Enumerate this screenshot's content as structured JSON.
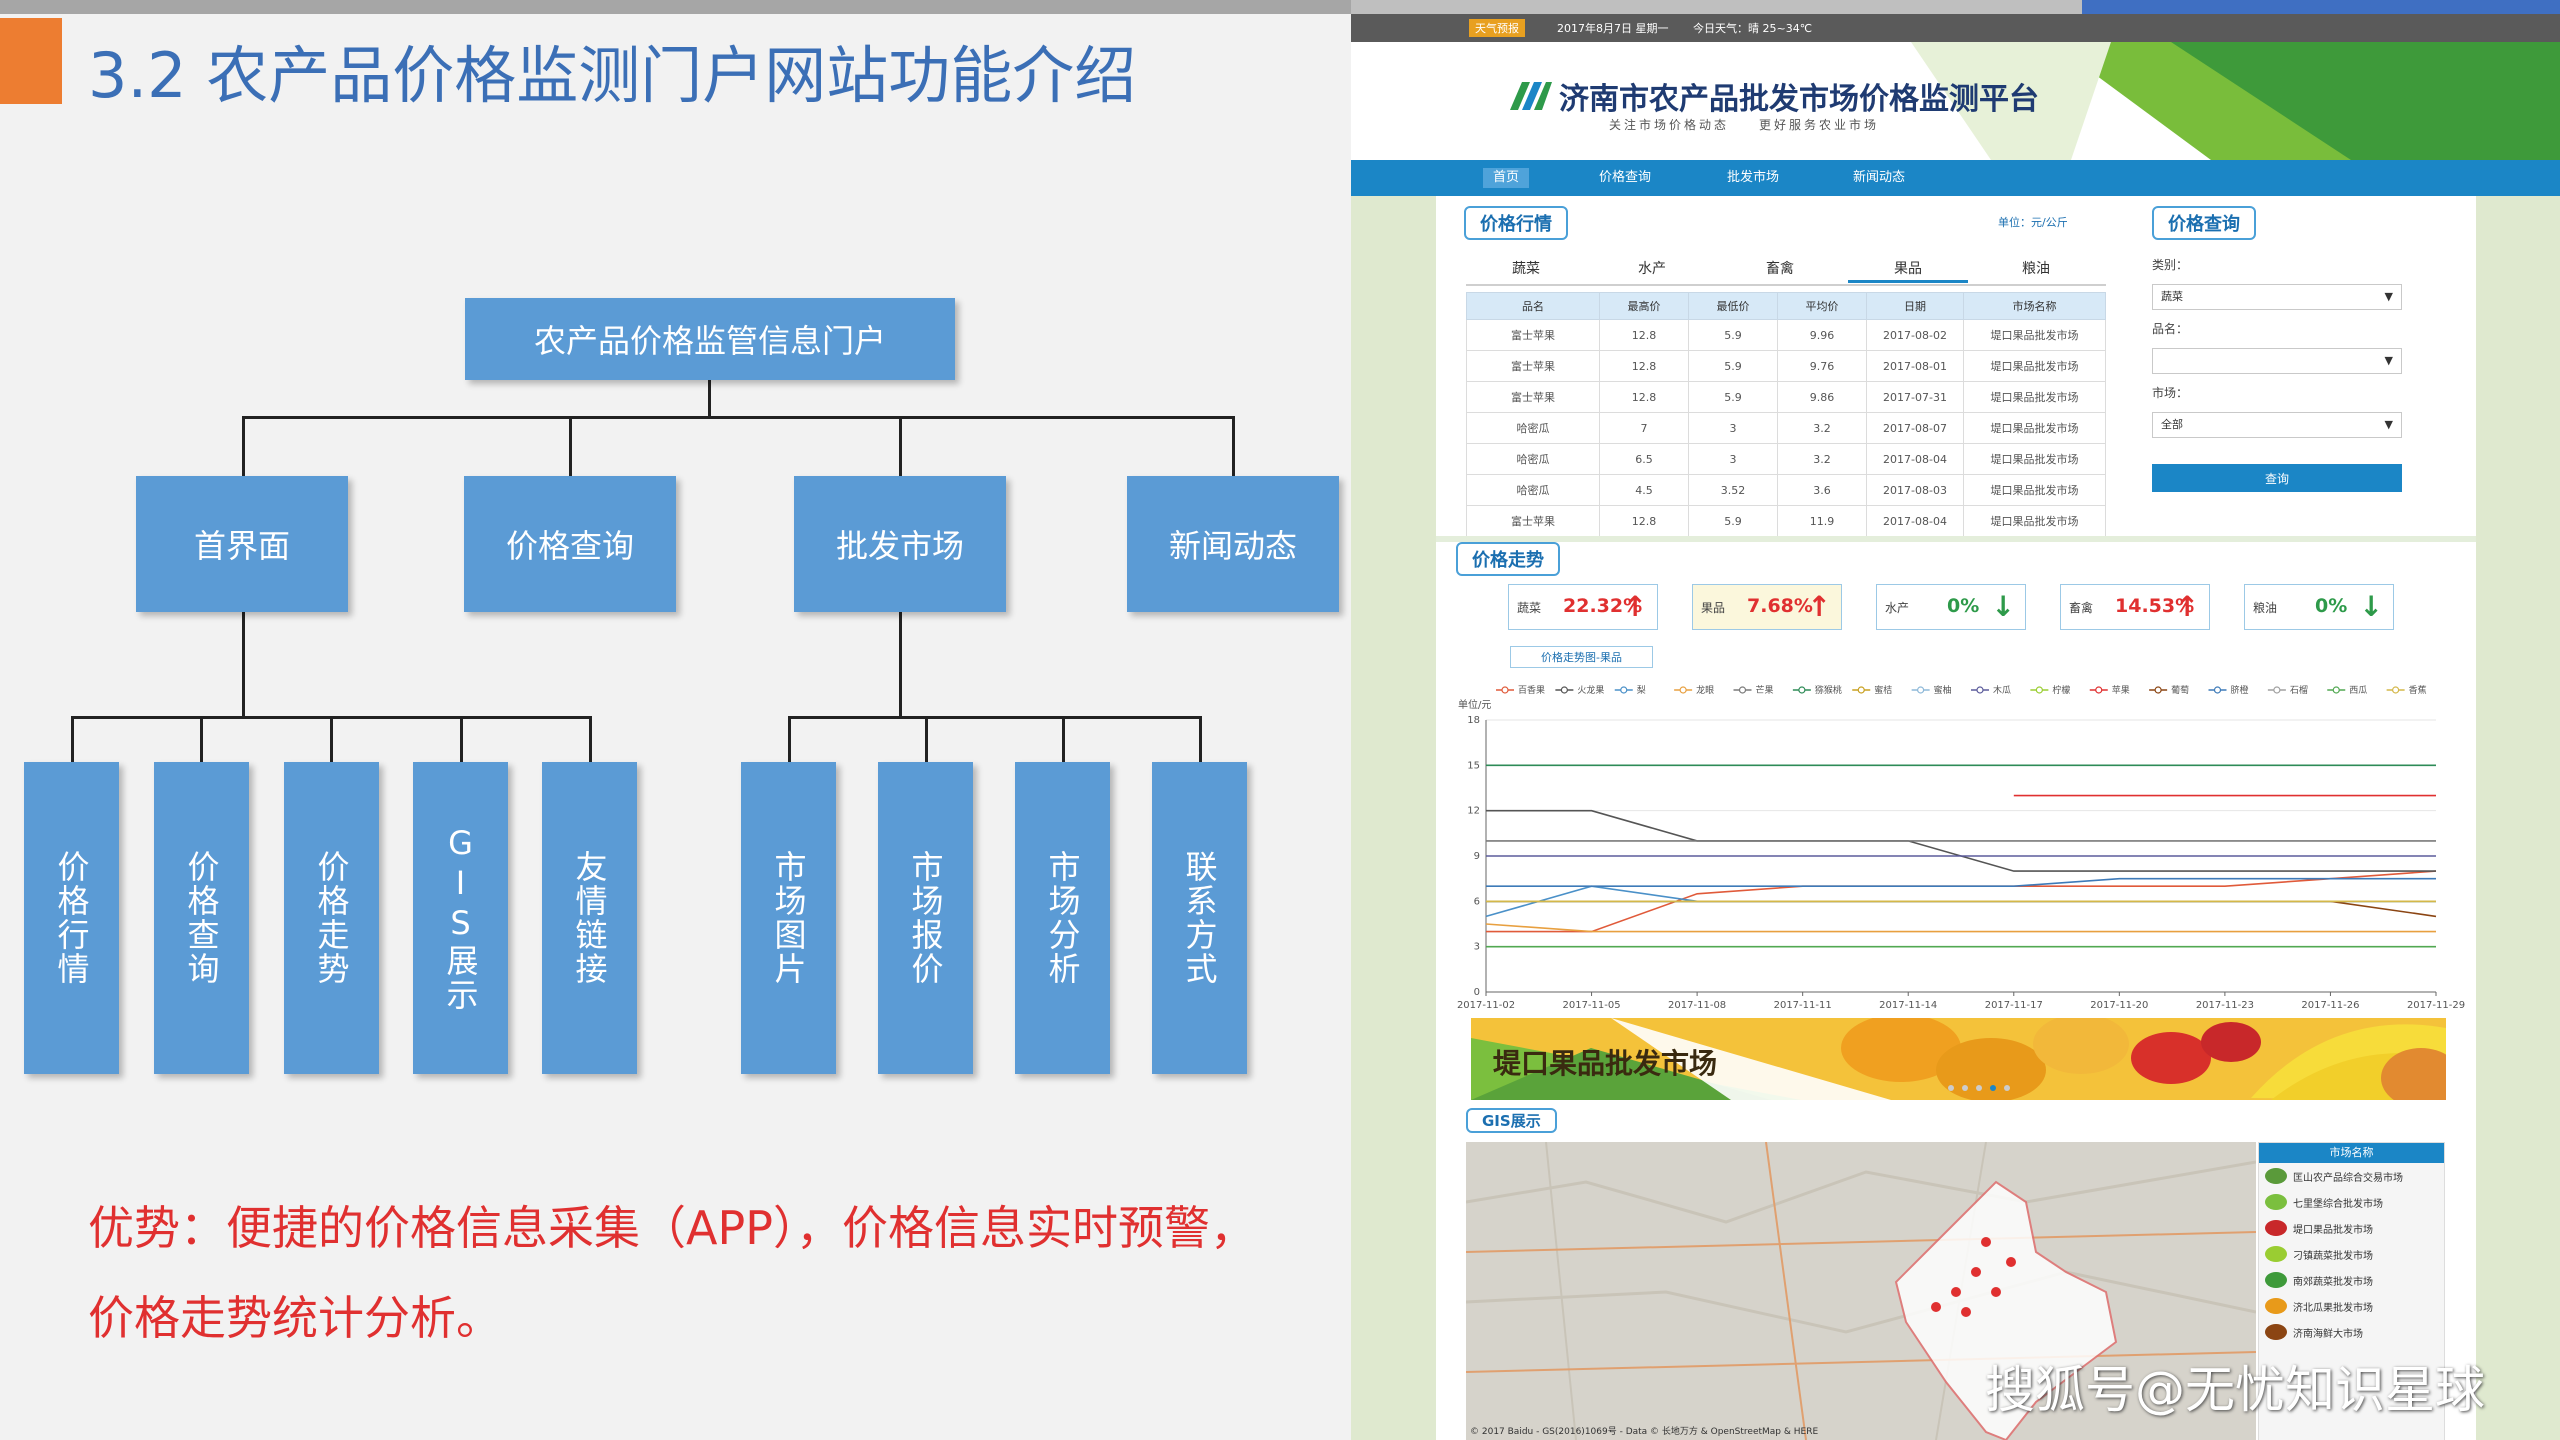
{
  "slide": {
    "title": "3.2 农产品价格监测门户网站功能介绍",
    "advantage_line1": "优势：便捷的价格信息采集（APP），价格信息实时预警，",
    "advantage_line2": "价格走势统计分析。",
    "colors": {
      "box": "#5b9bd5",
      "title": "#3b6fb6",
      "accent_tab": "#ed7d31",
      "advantage": "#e03030"
    }
  },
  "org_chart": {
    "root": "农产品价格监管信息门户",
    "level1": [
      "首界面",
      "价格查询",
      "批发市场",
      "新闻动态"
    ],
    "home_children": [
      "价格行情",
      "价格查询",
      "价格走势",
      "GIS展示",
      "友情链接"
    ],
    "market_children": [
      "市场图片",
      "市场报价",
      "市场分析",
      "联系方式"
    ]
  },
  "portal": {
    "topbar": {
      "weather_badge": "天气预报",
      "date": "2017年8月7日 星期一",
      "weather": "今日天气：晴 25~34℃"
    },
    "site_title": "济南市农产品批发市场价格监测平台",
    "site_slogan": "关注市场价格动态　　更好服务农业市场",
    "nav": [
      "首页",
      "价格查询",
      "批发市场",
      "新闻动态"
    ],
    "price_market": {
      "title": "价格行情",
      "unit": "单位：元/公斤",
      "tabs": [
        "蔬菜",
        "水产",
        "畜禽",
        "果品",
        "粮油"
      ],
      "active_tab": "果品",
      "columns": [
        "品名",
        "最高价",
        "最低价",
        "平均价",
        "日期",
        "市场名称"
      ],
      "rows": [
        [
          "富士苹果",
          "12.8",
          "5.9",
          "9.96",
          "2017-08-02",
          "堤口果品批发市场"
        ],
        [
          "富士苹果",
          "12.8",
          "5.9",
          "9.76",
          "2017-08-01",
          "堤口果品批发市场"
        ],
        [
          "富士苹果",
          "12.8",
          "5.9",
          "9.86",
          "2017-07-31",
          "堤口果品批发市场"
        ],
        [
          "哈密瓜",
          "7",
          "3",
          "3.2",
          "2017-08-07",
          "堤口果品批发市场"
        ],
        [
          "哈密瓜",
          "6.5",
          "3",
          "3.2",
          "2017-08-04",
          "堤口果品批发市场"
        ],
        [
          "哈密瓜",
          "4.5",
          "3.52",
          "3.6",
          "2017-08-03",
          "堤口果品批发市场"
        ],
        [
          "富士苹果",
          "12.8",
          "5.9",
          "11.9",
          "2017-08-04",
          "堤口果品批发市场"
        ]
      ]
    },
    "price_query": {
      "title": "价格查询",
      "category_label": "类别：",
      "category_value": "蔬菜",
      "product_label": "品名：",
      "product_value": "",
      "market_label": "市场：",
      "market_value": "全部",
      "button": "查询"
    },
    "price_trend": {
      "title": "价格走势",
      "cards": [
        {
          "name": "蔬菜",
          "pct": "22.32%",
          "arrow": "↑",
          "color": "#e03030",
          "bg": "#ffffff"
        },
        {
          "name": "果品",
          "pct": "7.68%",
          "arrow": "↑",
          "color": "#e03030",
          "bg": "#fbf7dc"
        },
        {
          "name": "水产",
          "pct": "0%",
          "arrow": "↓",
          "color": "#2e9a4a",
          "bg": "#ffffff"
        },
        {
          "name": "畜禽",
          "pct": "14.53%",
          "arrow": "↑",
          "color": "#e03030",
          "bg": "#ffffff"
        },
        {
          "name": "粮油",
          "pct": "0%",
          "arrow": "↓",
          "color": "#2e9a4a",
          "bg": "#ffffff"
        }
      ],
      "chart_tab": "价格走势图-果品"
    },
    "banner_text": "堤口果品批发市场",
    "gis": {
      "title": "GIS展示",
      "legend_title": "市场名称",
      "markets": [
        "匡山农产品综合交易市场",
        "七里堡综合批发市场",
        "堤口果品批发市场",
        "刁镇蔬菜批发市场",
        "南郊蔬菜批发市场",
        "济北瓜果批发市场",
        "济南海鲜大市场"
      ],
      "footer": "© 2017 Baidu - GS(2016)1069号 - Data © 长地万方 & OpenStreetMap & HERE"
    }
  },
  "watermark": "搜狐号@无忧知识星球",
  "chart_data": {
    "type": "line",
    "title": "",
    "ylabel": "单位/元",
    "xlabel": "",
    "categories": [
      "2017-11-02",
      "2017-11-05",
      "2017-11-08",
      "2017-11-11",
      "2017-11-14",
      "2017-11-17",
      "2017-11-20",
      "2017-11-23",
      "2017-11-26",
      "2017-11-29"
    ],
    "ylim": [
      0,
      18
    ],
    "yticks": [
      0,
      3,
      6,
      9,
      12,
      15,
      18
    ],
    "legend_position": "top",
    "grid": true,
    "series": [
      {
        "name": "百香果",
        "color": "#e05a3a",
        "values": [
          4,
          4,
          6.5,
          7,
          7,
          7,
          7,
          7,
          7.5,
          8
        ]
      },
      {
        "name": "火龙果",
        "color": "#555555",
        "values": [
          12,
          12,
          10,
          10,
          10,
          8,
          8,
          8,
          8,
          8
        ]
      },
      {
        "name": "梨",
        "color": "#4a90c8",
        "values": [
          5,
          7,
          6,
          6,
          6,
          6,
          6,
          6,
          6,
          6
        ]
      },
      {
        "name": "龙眼",
        "color": "#e8a040",
        "values": [
          4.5,
          4,
          4,
          4,
          4,
          4,
          4,
          4,
          4,
          4
        ]
      },
      {
        "name": "芒果",
        "color": "#7a7a7a",
        "values": [
          10,
          10,
          10,
          10,
          10,
          10,
          10,
          10,
          10,
          10
        ]
      },
      {
        "name": "猕猴桃",
        "color": "#2e8b57",
        "values": [
          15,
          15,
          15,
          15,
          15,
          15,
          15,
          15,
          15,
          15
        ]
      },
      {
        "name": "蜜桔",
        "color": "#c8a020",
        "values": [
          6,
          6,
          6,
          6,
          6,
          6,
          6,
          6,
          6,
          6
        ]
      },
      {
        "name": "蜜柚",
        "color": "#8db8d8",
        "values": [
          6,
          6,
          6,
          6,
          6,
          6,
          6,
          6,
          6,
          6
        ]
      },
      {
        "name": "木瓜",
        "color": "#5b5b9b",
        "values": [
          9,
          9,
          9,
          9,
          9,
          9,
          9,
          9,
          9,
          9
        ]
      },
      {
        "name": "柠檬",
        "color": "#9acd32",
        "values": [
          6,
          6,
          6,
          6,
          6,
          6,
          6,
          6,
          6,
          6
        ]
      },
      {
        "name": "苹果",
        "color": "#e03030",
        "values": [
          null,
          null,
          null,
          null,
          null,
          13,
          13,
          13,
          13,
          13
        ]
      },
      {
        "name": "葡萄",
        "color": "#8b4513",
        "values": [
          6,
          6,
          6,
          6,
          6,
          6,
          6,
          6,
          6,
          5
        ]
      },
      {
        "name": "脐橙",
        "color": "#3d7ab8",
        "values": [
          7,
          7,
          7,
          7,
          7,
          7,
          7.5,
          7.5,
          7.5,
          7.5
        ]
      },
      {
        "name": "石榴",
        "color": "#a0a0a0",
        "values": [
          6,
          6,
          6,
          6,
          6,
          6,
          6,
          6,
          6,
          6
        ]
      },
      {
        "name": "西瓜",
        "color": "#52a852",
        "values": [
          3,
          3,
          3,
          3,
          3,
          3,
          3,
          3,
          3,
          3
        ]
      },
      {
        "name": "香蕉",
        "color": "#d4b84a",
        "values": [
          6,
          6,
          6,
          6,
          6,
          6,
          6,
          6,
          6,
          6
        ]
      }
    ]
  }
}
